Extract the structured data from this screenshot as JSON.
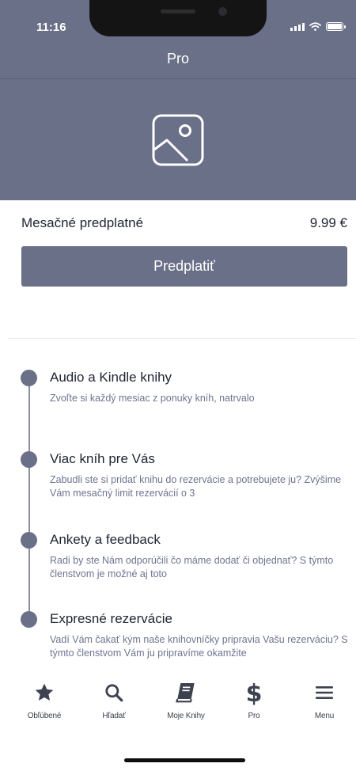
{
  "status_bar": {
    "time": "11:16"
  },
  "nav": {
    "title": "Pro"
  },
  "hero": {
    "icon": "image-placeholder-icon"
  },
  "subscription": {
    "label": "Mesačné predplatné",
    "price": "9.99 €",
    "button_label": "Predplatiť"
  },
  "features": [
    {
      "title": "Audio a Kindle knihy",
      "desc": "Zvoľte si každý mesiac z ponuky kníh, natrvalo"
    },
    {
      "title": "Viac kníh pre Vás",
      "desc": "Zabudli ste si pridať knihu do rezervácie a potrebujete ju? Zvýšime Vám mesačný limit rezervácií o 3"
    },
    {
      "title": "Ankety a feedback",
      "desc": "Radi by ste Nám odporúčili čo máme dodať či objednať? S týmto členstvom je možné aj toto"
    },
    {
      "title": "Expresné rezervácie",
      "desc": "Vadí Vám čakať kým naše knihovníčky pripravia Vašu rezerváciu? S týmto členstvom Vám ju pripravíme okamžite"
    }
  ],
  "tabs": [
    {
      "label": "Obľúbené",
      "icon": "star-icon"
    },
    {
      "label": "Hľadať",
      "icon": "search-icon"
    },
    {
      "label": "Moje Knihy",
      "icon": "book-icon"
    },
    {
      "label": "Pro",
      "icon": "dollar-icon"
    },
    {
      "label": "Menu",
      "icon": "menu-icon"
    }
  ],
  "colors": {
    "primary": "#6b7089",
    "muted_text": "#6f7490",
    "background": "#ffffff"
  }
}
